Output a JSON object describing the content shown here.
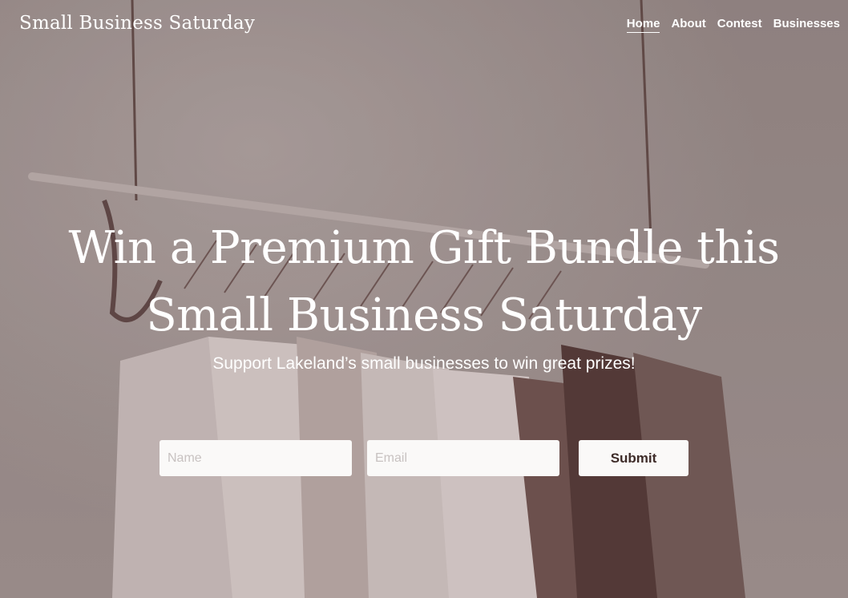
{
  "header": {
    "site_title": "Small Business Saturday",
    "nav": [
      {
        "label": "Home",
        "active": true
      },
      {
        "label": "About",
        "active": false
      },
      {
        "label": "Contest",
        "active": false
      },
      {
        "label": "Businesses",
        "active": false
      }
    ]
  },
  "hero": {
    "heading_line1": "Win a Premium Gift Bundle this",
    "heading_line2": "Small Business Saturday",
    "subheading": "Support Lakeland’s small businesses to win great prizes!"
  },
  "form": {
    "name_placeholder": "Name",
    "email_placeholder": "Email",
    "submit_label": "Submit"
  },
  "colors": {
    "overlay_tint": "#8f8381",
    "dark_garment": "#4e3431",
    "button_text": "#3e2c29"
  }
}
